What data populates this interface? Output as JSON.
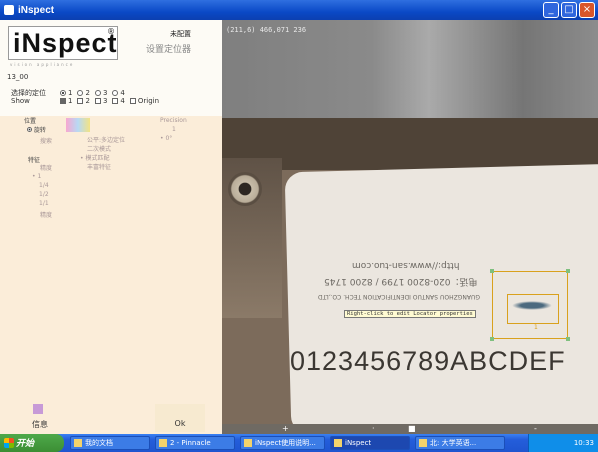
{
  "window": {
    "title": "iNspect",
    "minimize": "_",
    "maximize": "□",
    "close": "×"
  },
  "left_panel": {
    "logo": "iNspect",
    "logo_mark": "®",
    "logo_tagline": "vision appliance",
    "status_top": "未配置",
    "status_button": "设置定位器",
    "code": "13_00",
    "locator_label": "选择的定位",
    "show_label": "Show",
    "radio_options": [
      "1",
      "2",
      "3",
      "4"
    ],
    "check_options": [
      "1",
      "2",
      "3",
      "4"
    ],
    "origin_label": "Origin",
    "position_label": "位置",
    "rotate_label": "旋转",
    "search_label": "搜索",
    "features_label": "特征",
    "check_label": "精度",
    "bullet_items": [
      "1",
      "1/4",
      "1/2",
      "1/1"
    ],
    "precision_label": "精度",
    "hint1": "公平:多边定位",
    "hint2": "二次模式",
    "hint3": "模式匹配",
    "hint4": "丰富特征",
    "right_hint1": "Precision",
    "right_hint2": "1",
    "right_hint3": "0°",
    "info_label": "信息",
    "ok_label": "Ok"
  },
  "camera": {
    "coord": "(211,6) 466,071 236",
    "url_line": "http://www.san-tuo.com",
    "phone_line": "电话：020-8200 1799 / 8200 1745",
    "company_line": "GUANGZHOU SANTUO IDENTIFICATION TECH. CO.,LTD",
    "barcode_text": "0123456789ABCDEF",
    "tooltip": "Right-click to edit Locator properties",
    "roi_label": "1"
  },
  "bottom_strip": {
    "items": [
      "+",
      "·",
      "■",
      "-"
    ]
  },
  "taskbar": {
    "start": "开始",
    "tasks": [
      "我的文档",
      "2 - Pinnacle",
      "iNspect使用说明...",
      "iNspect",
      "北: 大学英语..."
    ],
    "clock": "10:33"
  }
}
